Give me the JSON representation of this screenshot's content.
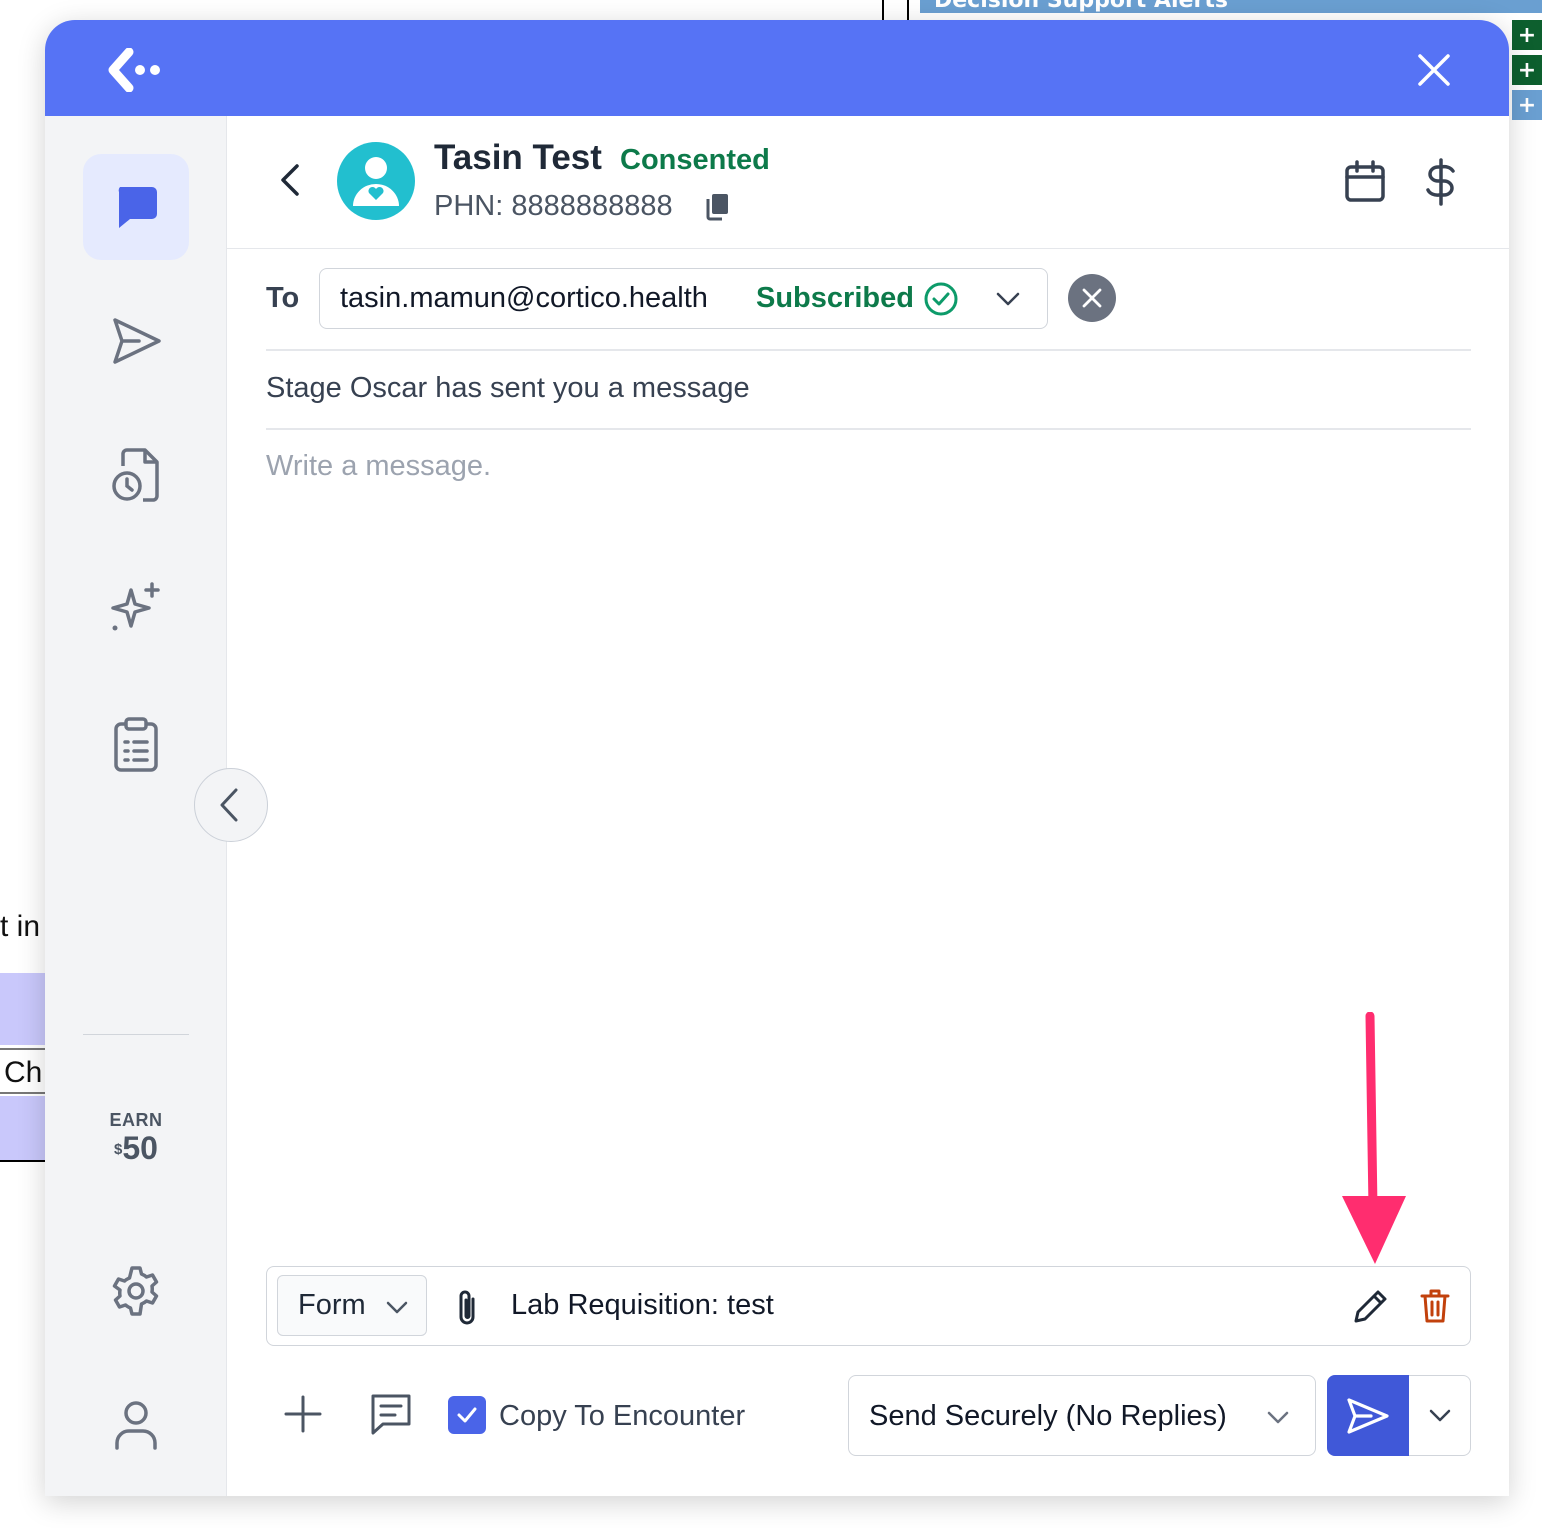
{
  "background": {
    "banner_title": "Decision Support Alerts",
    "fragment_text_1": "t in",
    "fragment_text_2": "Ch"
  },
  "window": {
    "topbar_color": "#5673f5",
    "close_icon": "close-icon",
    "logo_icon": "cortico-logo"
  },
  "sidebar": {
    "items": [
      {
        "icon": "chat-bubble-icon",
        "active": true
      },
      {
        "icon": "send-icon",
        "active": false
      },
      {
        "icon": "scheduled-document-icon",
        "active": false
      },
      {
        "icon": "sparkles-icon",
        "active": false
      },
      {
        "icon": "clipboard-list-icon",
        "active": false
      }
    ],
    "earn_label": "EARN",
    "earn_currency": "$",
    "earn_amount": "50",
    "bottom_items": [
      {
        "icon": "gear-icon"
      },
      {
        "icon": "user-icon"
      }
    ]
  },
  "patient": {
    "name": "Tasin Test",
    "consent_status": "Consented",
    "phn": "PHN: 8888888888"
  },
  "compose": {
    "to_label": "To",
    "recipient_email": "tasin.mamun@cortico.health",
    "recipient_status": "Subscribed",
    "subject": "Stage Oscar has sent you a message",
    "message_placeholder": "Write a message.",
    "message_value": ""
  },
  "attachment": {
    "type": "Form",
    "name": "Lab Requisition: test"
  },
  "footer": {
    "copy_to_encounter_label": "Copy To Encounter",
    "copy_to_encounter_checked": true,
    "send_mode": "Send Securely (No Replies)"
  },
  "colors": {
    "accent": "#4058d8",
    "success": "#0d7a4a",
    "danger": "#c2410c",
    "annotation_arrow": "#ff2d6f"
  }
}
